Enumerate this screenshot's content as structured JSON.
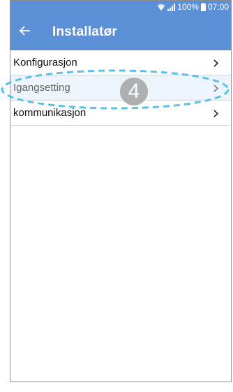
{
  "statusbar": {
    "battery": "100%",
    "time": "07:00",
    "wifi_icon": "wifi-icon",
    "signal_icon": "signal-icon",
    "battery_icon": "battery-icon"
  },
  "appbar": {
    "back_icon": "arrow-left-icon",
    "title": "Installatør"
  },
  "menu": {
    "items": [
      {
        "label": "Konfigurasjon"
      },
      {
        "label": "Igangsetting"
      },
      {
        "label": "kommunikasjon"
      }
    ]
  },
  "annotation": {
    "step_number": "4",
    "highlight_color": "#5bc0e8",
    "badge_color": "#a8a8a8"
  },
  "colors": {
    "primary": "#5b8fd6",
    "divider": "#d9d9d9"
  }
}
